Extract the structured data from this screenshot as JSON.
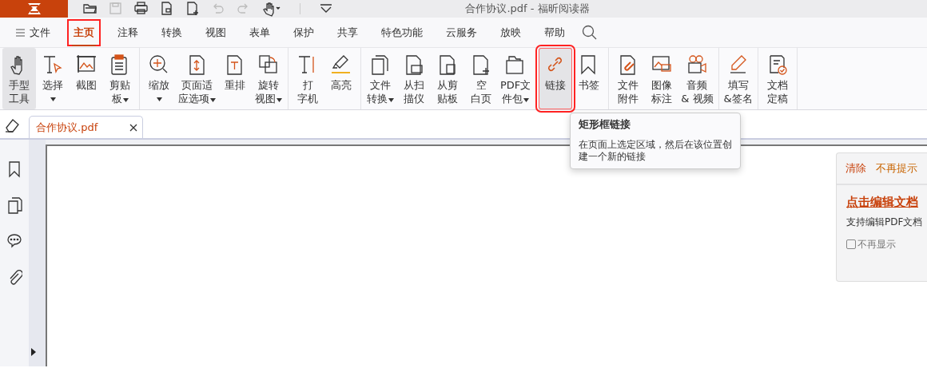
{
  "window": {
    "title": "合作协议.pdf - 福昕阅读器"
  },
  "quick_toolbar": [
    {
      "disabled": false
    },
    {
      "disabled": true
    },
    {
      "disabled": false
    },
    {
      "disabled": false
    },
    {
      "disabled": false
    },
    {
      "disabled": true
    },
    {
      "disabled": true
    },
    {
      "disabled": false
    },
    {
      "disabled": false
    }
  ],
  "menu_tabs": [
    {
      "label": "文件",
      "selected": false,
      "annotated": false
    },
    {
      "label": "主页",
      "selected": true,
      "annotated": true
    },
    {
      "label": "注释",
      "selected": false,
      "annotated": false
    },
    {
      "label": "转换",
      "selected": false,
      "annotated": false
    },
    {
      "label": "视图",
      "selected": false,
      "annotated": false
    },
    {
      "label": "表单",
      "selected": false,
      "annotated": false
    },
    {
      "label": "保护",
      "selected": false,
      "annotated": false
    },
    {
      "label": "共享",
      "selected": false,
      "annotated": false
    },
    {
      "label": "特色功能",
      "selected": false,
      "annotated": false
    },
    {
      "label": "云服务",
      "selected": false,
      "annotated": false
    },
    {
      "label": "放映",
      "selected": false,
      "annotated": false
    },
    {
      "label": "帮助",
      "selected": false,
      "annotated": false
    }
  ],
  "ribbon_groups": [
    {
      "items": [
        {
          "lines": [
            "手型",
            "工具"
          ],
          "dropdown": false,
          "selected": true
        },
        {
          "lines": [
            "选择"
          ],
          "dropdown": true,
          "selected": false
        },
        {
          "lines": [
            "截图"
          ],
          "dropdown": false,
          "selected": false
        },
        {
          "lines": [
            "剪贴",
            "板"
          ],
          "dropdown": true,
          "selected": false
        }
      ]
    },
    {
      "items": [
        {
          "lines": [
            "缩放"
          ],
          "dropdown": true,
          "selected": false
        },
        {
          "lines": [
            "页面适",
            "应选项"
          ],
          "dropdown": true,
          "selected": false
        },
        {
          "lines": [
            "重排"
          ],
          "dropdown": false,
          "selected": false
        },
        {
          "lines": [
            "旋转",
            "视图"
          ],
          "dropdown": true,
          "selected": false
        }
      ]
    },
    {
      "items": [
        {
          "lines": [
            "打",
            "字机"
          ],
          "dropdown": false,
          "selected": false
        },
        {
          "lines": [
            "高亮"
          ],
          "dropdown": false,
          "selected": false
        }
      ]
    },
    {
      "items": [
        {
          "lines": [
            "文件",
            "转换"
          ],
          "dropdown": true,
          "selected": false
        },
        {
          "lines": [
            "从扫",
            "描仪"
          ],
          "dropdown": false,
          "selected": false
        },
        {
          "lines": [
            "从剪",
            "贴板"
          ],
          "dropdown": false,
          "selected": false
        },
        {
          "lines": [
            "空",
            "白页"
          ],
          "dropdown": false,
          "selected": false
        },
        {
          "lines": [
            "PDF文",
            "件包"
          ],
          "dropdown": true,
          "selected": false
        }
      ]
    },
    {
      "items": [
        {
          "lines": [
            "链接"
          ],
          "dropdown": false,
          "selected": true,
          "annotated": true
        },
        {
          "lines": [
            "书签"
          ],
          "dropdown": false,
          "selected": false
        }
      ]
    },
    {
      "items": [
        {
          "lines": [
            "文件",
            "附件"
          ],
          "dropdown": false,
          "selected": false
        },
        {
          "lines": [
            "图像",
            "标注"
          ],
          "dropdown": false,
          "selected": false
        },
        {
          "lines": [
            "音频",
            "& 视频"
          ],
          "dropdown": false,
          "selected": false
        }
      ]
    },
    {
      "items": [
        {
          "lines": [
            "填写",
            "&签名"
          ],
          "dropdown": false,
          "selected": false
        }
      ]
    },
    {
      "items": [
        {
          "lines": [
            "文档",
            "定稿"
          ],
          "dropdown": false,
          "selected": false
        }
      ]
    }
  ],
  "tooltip": {
    "title": "矩形框链接",
    "text": "在页面上选定区域，然后在该位置创建一个新的链接"
  },
  "document_tabs": [
    {
      "label": "合作协议.pdf",
      "selected": true
    }
  ],
  "edit_panel": {
    "clear": "清除",
    "dismiss": "不再提示",
    "link": "点击编辑文档",
    "description": "支持编辑PDF文档",
    "checkbox": {
      "label": "不再显示",
      "checked": false
    }
  }
}
